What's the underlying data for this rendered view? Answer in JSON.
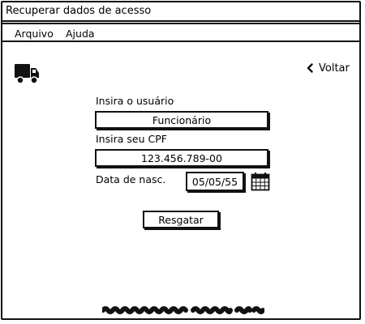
{
  "window": {
    "title": "Recuperar dados de acesso"
  },
  "menu": {
    "items": [
      "Arquivo",
      "Ajuda"
    ]
  },
  "nav": {
    "back_label": "Voltar"
  },
  "form": {
    "user_label": "Insira o usuário",
    "user_value": "Funcionário",
    "cpf_label": "Insira seu CPF",
    "cpf_value": "123.456.789-00",
    "birth_label": "Data de nasc.",
    "birth_value": "05/05/55",
    "submit_label": "Resgatar"
  },
  "icons": {
    "logo": "truck-icon",
    "back": "chevron-left-icon",
    "date_picker": "calendar-icon"
  }
}
